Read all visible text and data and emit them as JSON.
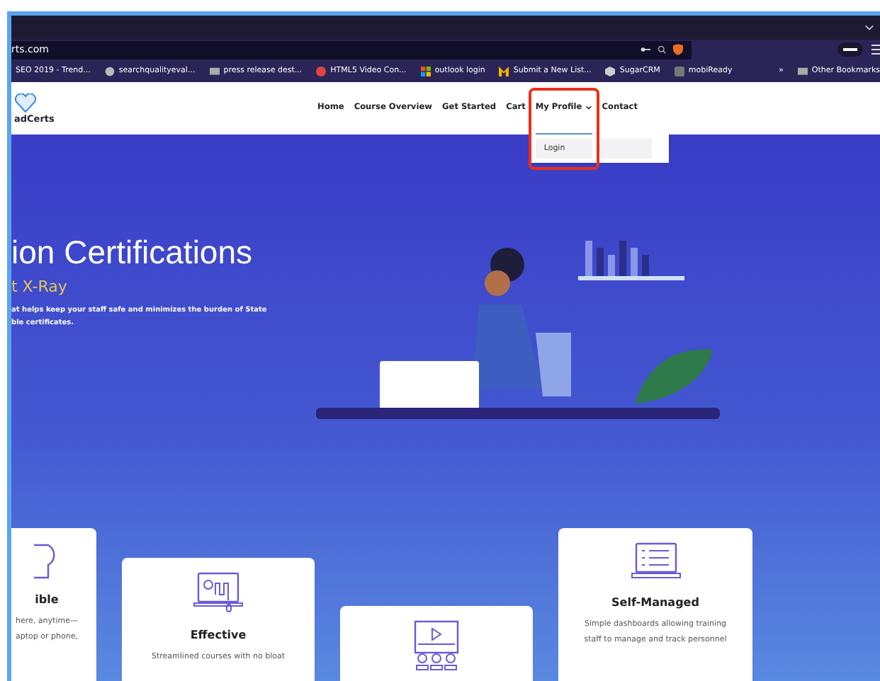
{
  "browser": {
    "address": "rts.com",
    "bookmarks": [
      "SEO 2019 - Trend...",
      "searchqualityeval...",
      "press release dest...",
      "HTML5 Video Con...",
      "outlook login",
      "Submit a New List...",
      "SugarCRM",
      "mobiReady"
    ],
    "more": "»",
    "other_bookmarks": "Other Bookmarks"
  },
  "site": {
    "logo": "adCerts",
    "nav": [
      {
        "label": "Home",
        "open": false
      },
      {
        "label": "Course Overview",
        "open": false
      },
      {
        "label": "Get Started",
        "open": false
      },
      {
        "label": "Cart",
        "open": false
      },
      {
        "label": "My Profile",
        "open": true
      },
      {
        "label": "Contact",
        "open": false
      }
    ],
    "dropdown": [
      "Login"
    ]
  },
  "hero": {
    "title": "ion Certifications",
    "subtitle": "t X-Ray",
    "lines": [
      "at helps keep your staff safe and minimizes the burden of State",
      "ble certificates."
    ]
  },
  "cards": [
    {
      "title": "ible",
      "lines": [
        "here, anytime—",
        "aptop or phone,"
      ]
    },
    {
      "title": "Effective",
      "lines": [
        "Streamlined courses with no bloat"
      ]
    },
    {
      "title": "Self-Managed",
      "lines": [
        "Simple dashboards allowing training",
        "staff to manage and track personnel"
      ]
    }
  ]
}
